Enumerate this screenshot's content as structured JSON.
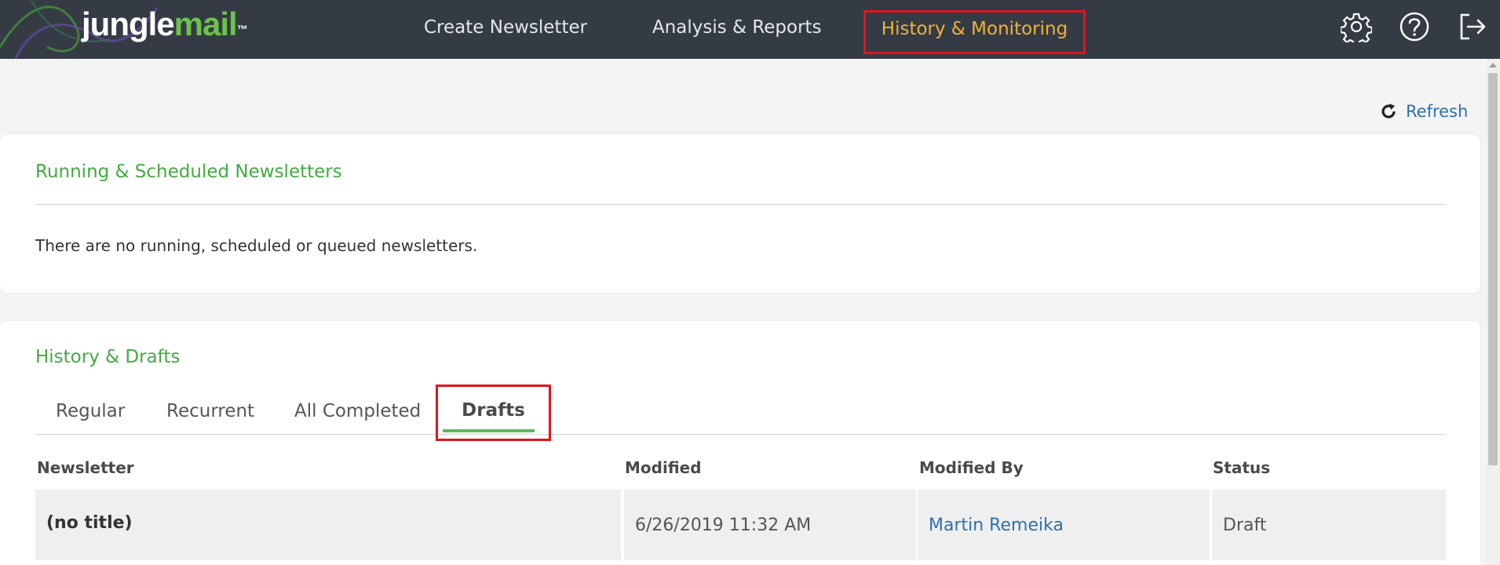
{
  "app": {
    "logo_part1": "jungle",
    "logo_part2": "mail",
    "logo_tm": "™"
  },
  "nav": {
    "create": "Create Newsletter",
    "analysis": "Analysis & Reports",
    "history": "History & Monitoring",
    "icons": [
      "gear-icon",
      "help-icon",
      "logout-icon"
    ]
  },
  "toolbar": {
    "refresh_label": "Refresh"
  },
  "running": {
    "title": "Running & Scheduled Newsletters",
    "empty_message": "There are no running, scheduled or queued newsletters."
  },
  "history": {
    "title": "History & Drafts",
    "tabs": [
      "Regular",
      "Recurrent",
      "All Completed",
      "Drafts"
    ],
    "active_tab": "Drafts",
    "columns": [
      "Newsletter",
      "Modified",
      "Modified By",
      "Status"
    ],
    "rows": [
      {
        "newsletter": "(no title)",
        "modified": "6/26/2019 11:32 AM",
        "modified_by": "Martin Remeika",
        "status": "Draft"
      }
    ]
  },
  "colors": {
    "topbar_bg": "#343b45",
    "accent_green": "#43ab3f",
    "nav_active": "#f2b134",
    "highlight_red": "#e0141e",
    "link_blue": "#2f6fb0"
  }
}
